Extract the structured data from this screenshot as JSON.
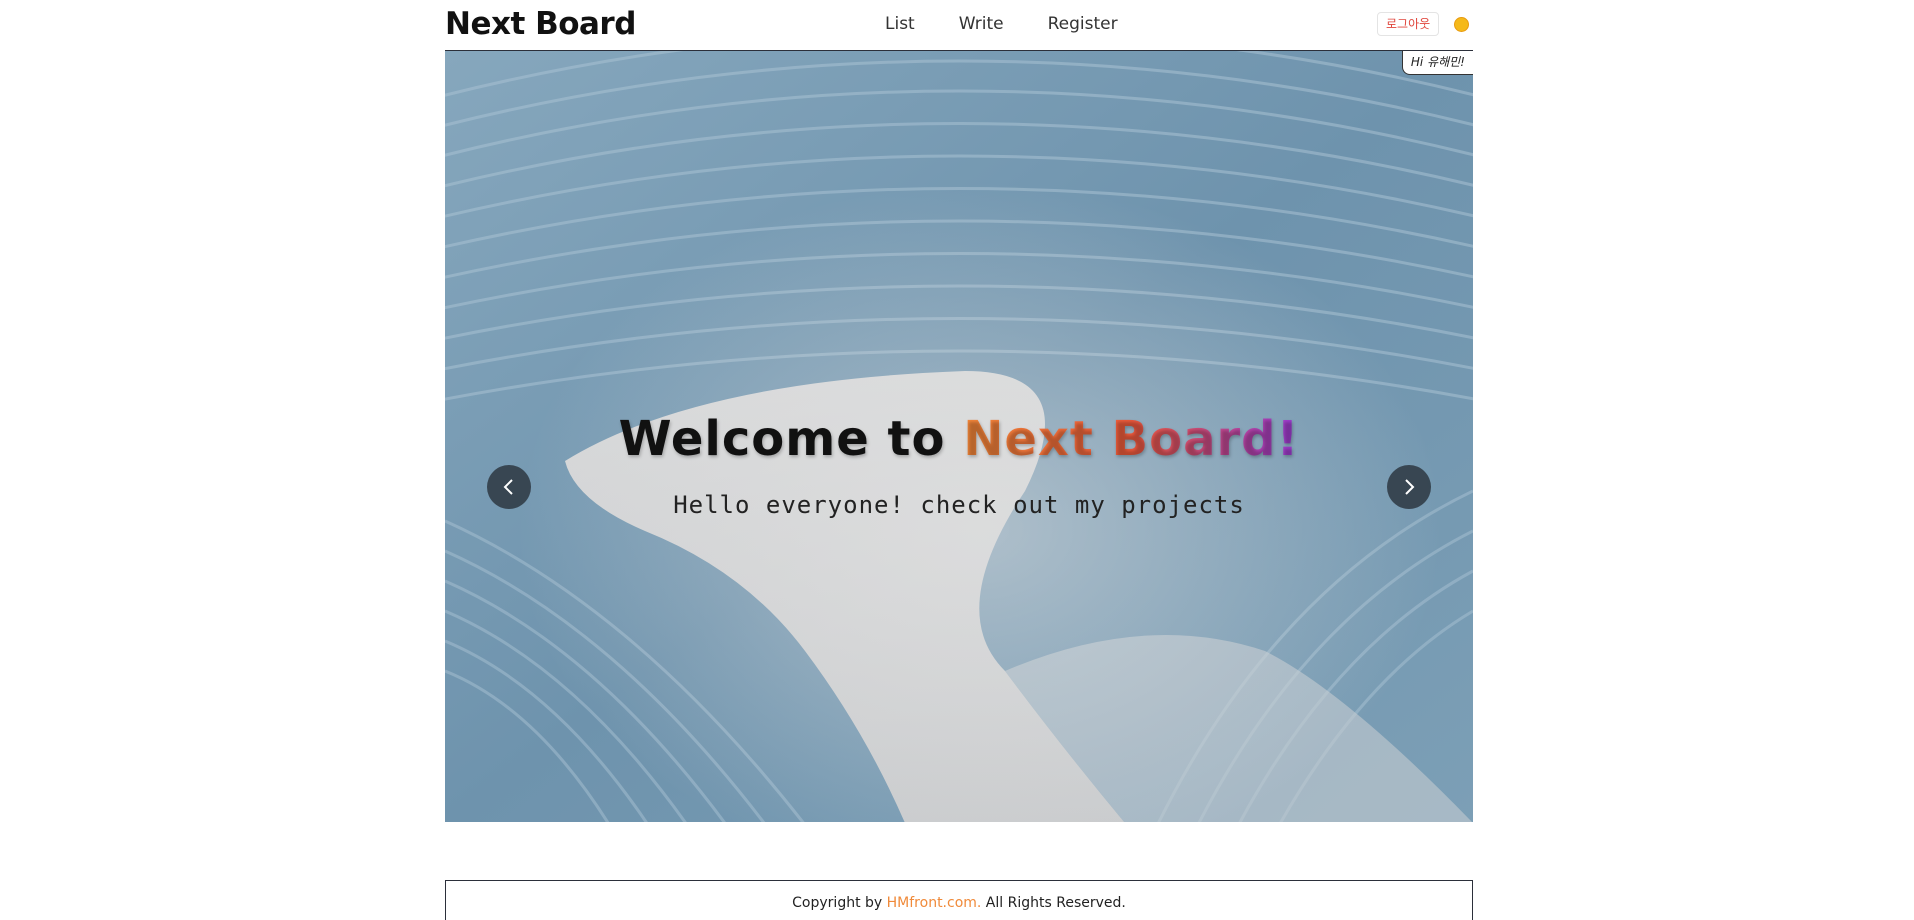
{
  "header": {
    "logo": "Next Board",
    "nav": [
      {
        "label": "List"
      },
      {
        "label": "Write"
      },
      {
        "label": "Register"
      }
    ],
    "logout_label": "로그아웃",
    "theme_icon": "sun-icon",
    "theme_color": "#f5b91a"
  },
  "hero": {
    "greeting": "Hi 유해민!",
    "title_prefix": "Welcome to ",
    "title_highlight": "Next Board!",
    "subtitle": "Hello everyone! check out my projects",
    "prev_icon": "chevron-left-icon",
    "next_icon": "chevron-right-icon",
    "highlight_gradient": [
      "#f5893a",
      "#ef5a3c",
      "#9b3bd8"
    ]
  },
  "footer": {
    "prefix": "Copyright by ",
    "link": "HMfront.com.",
    "suffix": " All Rights Reserved.",
    "link_color": "#f08a3a"
  }
}
